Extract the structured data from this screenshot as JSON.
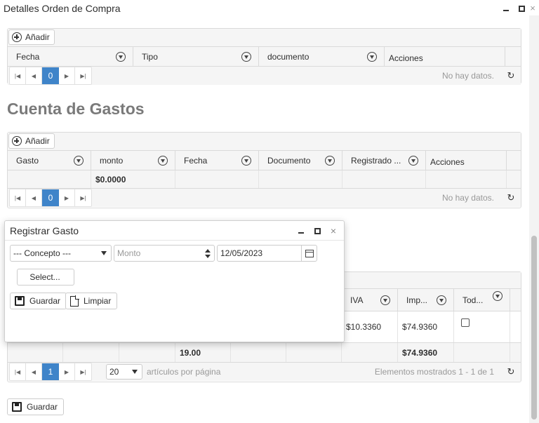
{
  "window": {
    "title": "Detalles Orden de Compra",
    "outer_close": "×"
  },
  "grid1": {
    "add_label": "Añadir",
    "columns": [
      "Fecha",
      "Tipo",
      "documento",
      "Acciones"
    ],
    "pager": {
      "page": "0",
      "info": "No hay datos."
    }
  },
  "section_title": "Cuenta de Gastos",
  "grid2": {
    "add_label": "Añadir",
    "columns": [
      "Gasto",
      "monto",
      "Fecha",
      "Documento",
      "Registrado ...",
      "Acciones"
    ],
    "footer_monto": "$0.0000",
    "pager": {
      "page": "0",
      "info": "No hay datos."
    }
  },
  "grid3": {
    "columns_visible": [
      "IVA",
      "Imp...",
      "Tod..."
    ],
    "row": {
      "iva": "$10.3360",
      "imp": "$74.9360"
    },
    "footer": {
      "qty": "19.00",
      "imp": "$74.9360"
    },
    "pager": {
      "page": "1",
      "page_size": "20",
      "per_page_label": "artículos por página",
      "info": "Elementos mostrados 1 - 1 de 1"
    }
  },
  "modal": {
    "title": "Registrar Gasto",
    "concepto_value": "--- Concepto ---",
    "monto_placeholder": "Monto",
    "fecha_value": "12/05/2023",
    "select_label": "Select...",
    "guardar_label": "Guardar",
    "limpiar_label": "Limpiar"
  },
  "bottom": {
    "guardar_label": "Guardar"
  },
  "colors": {
    "accent": "#3f84c9",
    "section_title": "#7a7a7a"
  }
}
